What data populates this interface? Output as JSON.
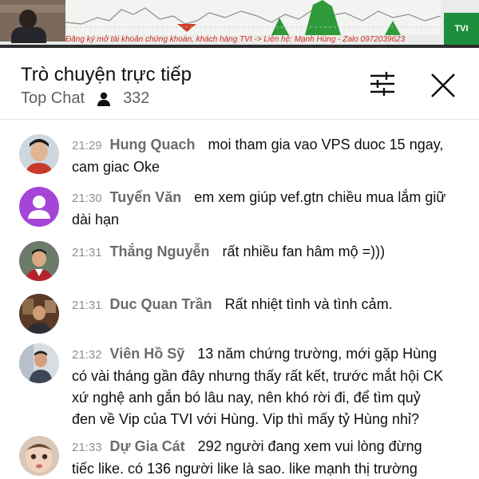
{
  "video": {
    "banner_text": "Đăng ký mở tài khoản chứng khoán, khách hàng TVI -> Liên hệ: Mạnh Hùng - Zalo 0972039623",
    "logo_text": "TVI"
  },
  "header": {
    "title": "Trò chuyện trực tiếp",
    "mode_label": "Top Chat",
    "viewer_count": "332"
  },
  "messages": [
    {
      "time": "21:29",
      "author": "Hung Quach",
      "text": "moi tham gia vao VPS duoc 15 ngay, cam giac Oke"
    },
    {
      "time": "21:30",
      "author": "Tuyển Văn",
      "text": "em xem giúp vef.gtn chiều mua lắm giữ dài hạn"
    },
    {
      "time": "21:31",
      "author": "Thắng Nguyễn",
      "text": "rất nhiều fan hâm mộ =)))"
    },
    {
      "time": "21:31",
      "author": "Duc Quan Trần",
      "text": "Rất nhiệt tình và tình cảm."
    },
    {
      "time": "21:32",
      "author": "Viên Hồ Sỹ",
      "text": "13 năm chứng trường, mới gặp Hùng có vài tháng gần đây nhưng thấy rất kết, trước mắt hội CK xứ nghệ anh gắn bó lâu nay, nên khó rời đi, để tìm quỷ đen về Vip của TVI với Hùng. Vip thì mấy tỷ Hùng nhỉ?"
    },
    {
      "time": "21:33",
      "author": "Dự Gia Cát",
      "text": "292 người đang xem vui lòng đừng tiếc like. có 136 người like là sao. like mạnh thị trường"
    }
  ],
  "colors": {
    "author": "#6b6b6b",
    "time": "#909090",
    "banner": "#d12a1a",
    "logo_bg": "#1d8f3c",
    "default_avatar": "#a545d8"
  }
}
